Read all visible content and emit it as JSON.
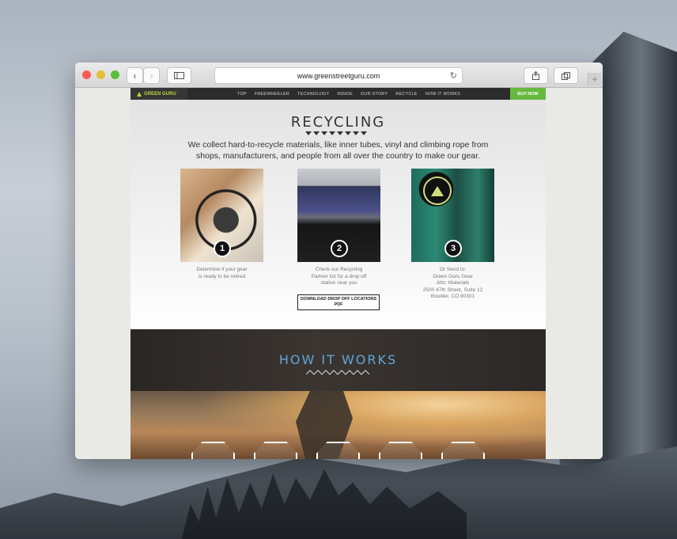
{
  "browser": {
    "url": "www.greenstreetguru.com"
  },
  "site_nav": {
    "logo": "GREEN GURU",
    "links": [
      "TOP",
      "FREEWHEELER",
      "TECHNOLOGY",
      "INSIDE",
      "OUR STORY",
      "RECYCLE",
      "HOW IT WORKS"
    ],
    "buy_now": "BUY NOW"
  },
  "recycling": {
    "title": "RECYCLING",
    "intro_line1": "We collect hard-to-recycle materials, like inner tubes, vinyl and climbing rope from",
    "intro_line2": "shops, manufacturers, and people from all over the country to make our gear.",
    "steps": [
      {
        "number": "1",
        "lines": [
          "Determine if your gear",
          "is ready to be retired"
        ]
      },
      {
        "number": "2",
        "lines": [
          "Check our Recycling",
          "Partner list for a drop off",
          "station near you"
        ],
        "button": "DOWNLOAD DROP OFF LOCATIONS PDF"
      },
      {
        "number": "3",
        "lines": [
          "Or Send to:",
          "Green Guru Gear",
          "Attn: Materials",
          "2500 47th Street, Suite 12",
          "Boulder, CO 80301"
        ]
      }
    ]
  },
  "how_it_works": {
    "title": "HOW IT WORKS"
  }
}
